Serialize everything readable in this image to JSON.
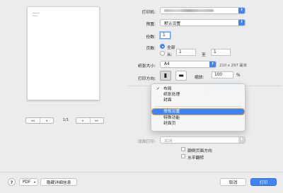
{
  "preview": {
    "page_counter": "1/1",
    "first_page": "◂◂",
    "prev_page": "◂",
    "next_page": "▸",
    "last_page": "▸▸"
  },
  "printer": {
    "label": "打印机:"
  },
  "presets": {
    "label": "预置:",
    "value": "默认设置"
  },
  "copies": {
    "label": "份数:",
    "value": "1"
  },
  "pages": {
    "label": "页数:",
    "all_label": "全部",
    "from_label": "从:",
    "from_value": "1",
    "to_label": "至",
    "to_value": "1"
  },
  "paper_size": {
    "label": "纸张大小:",
    "value": "A4",
    "dimensions": "210 x 297 毫米"
  },
  "orientation": {
    "label": "打印方向:",
    "portrait_glyph": "▮",
    "landscape_glyph": "▬"
  },
  "scale": {
    "label": "缩放:",
    "value": "100",
    "unit": "%"
  },
  "menu": {
    "items": [
      {
        "label": "布局",
        "checked": true,
        "tick": "✓"
      },
      {
        "label": "纸张处理"
      },
      {
        "label": "封面"
      },
      {
        "label": "常规设置",
        "highlighted": true
      },
      {
        "label": "特殊功能"
      },
      {
        "label": "封面页"
      }
    ]
  },
  "duplex": {
    "label": "双面打印:",
    "value": "关闭"
  },
  "checkboxes": {
    "reverse": "颠倒页面方向",
    "flip": "水平翻转"
  },
  "bottom_bar": {
    "help": "?",
    "pdf": "PDF",
    "hide_details": "隐藏详细信息",
    "cancel": "取消",
    "print": "打印"
  },
  "colors": {
    "accent": "#3f83f5",
    "focus_ring": "#f3a33a",
    "background": "#ececec"
  }
}
